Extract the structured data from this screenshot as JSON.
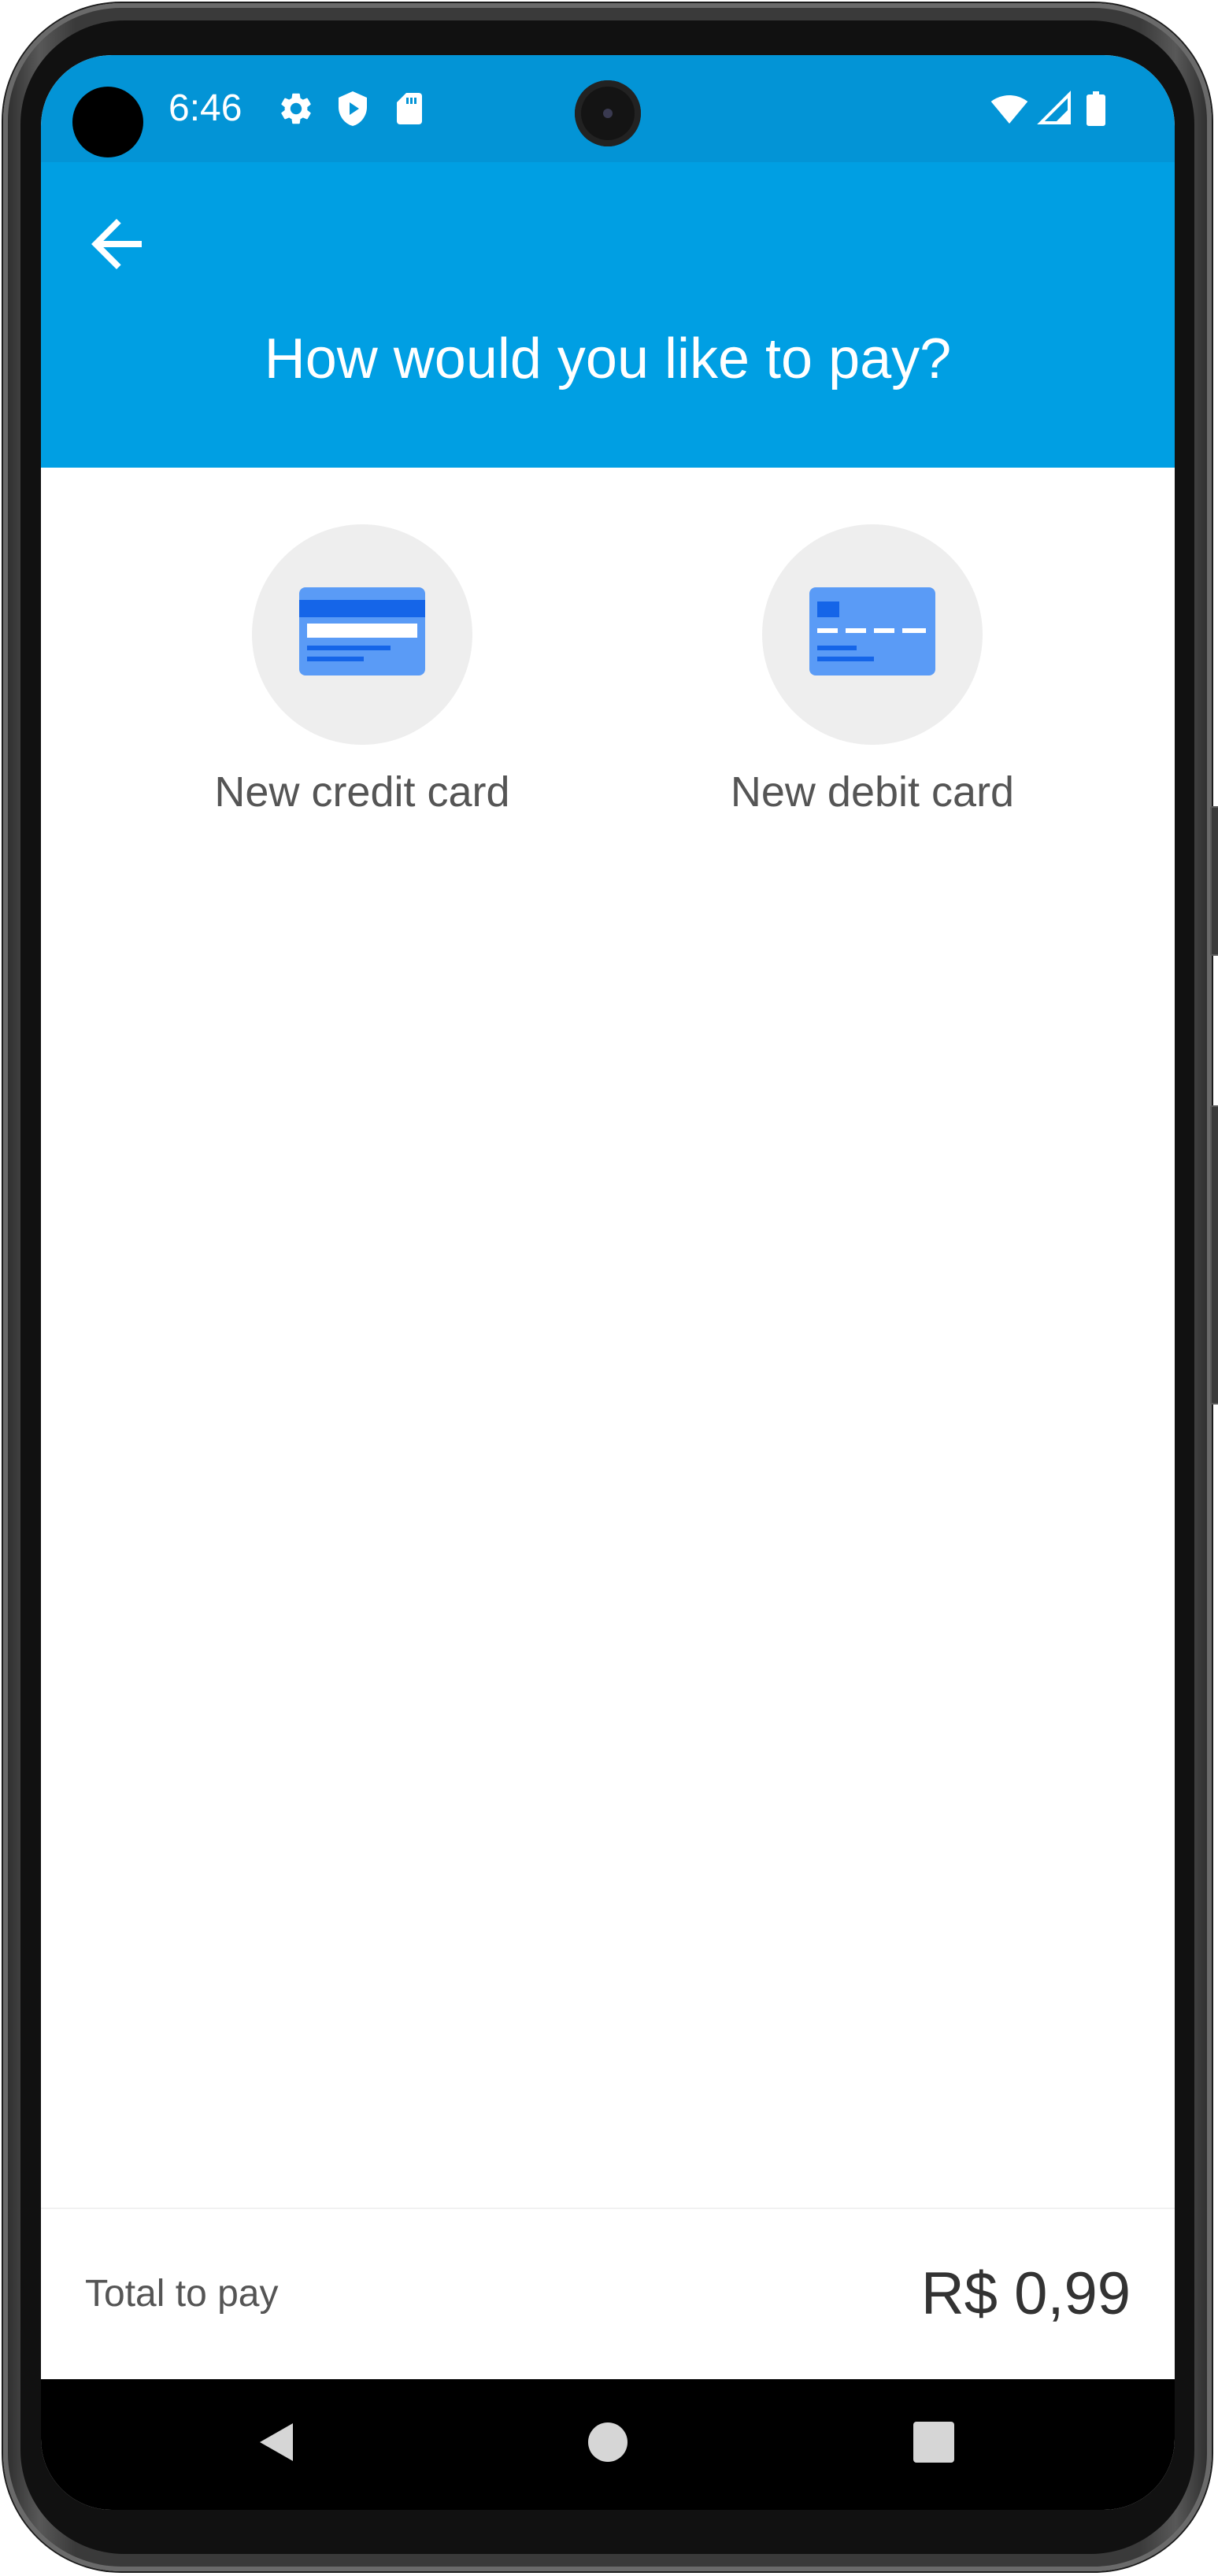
{
  "status_bar": {
    "time": "6:46",
    "icons_left": [
      "gear-icon",
      "shield-play-icon",
      "sd-card-icon"
    ],
    "icons_right": [
      "wifi-icon",
      "signal-icon",
      "battery-icon"
    ]
  },
  "header": {
    "back_icon": "arrow-left-icon",
    "title": "How would you like to pay?",
    "background_color": "#009fe3"
  },
  "payment_options": [
    {
      "label": "New credit card",
      "icon": "credit-card-icon"
    },
    {
      "label": "New debit card",
      "icon": "debit-card-icon"
    }
  ],
  "footer": {
    "total_label": "Total to pay",
    "total_value": "R$ 0,99"
  },
  "navigation": {
    "buttons": [
      "back-triangle-icon",
      "home-circle-icon",
      "recents-square-icon"
    ]
  },
  "colors": {
    "status_bar": "#0394d6",
    "app_bar": "#009fe3",
    "card_blue": "#5a9bf6",
    "card_dark_blue": "#1565e8"
  }
}
